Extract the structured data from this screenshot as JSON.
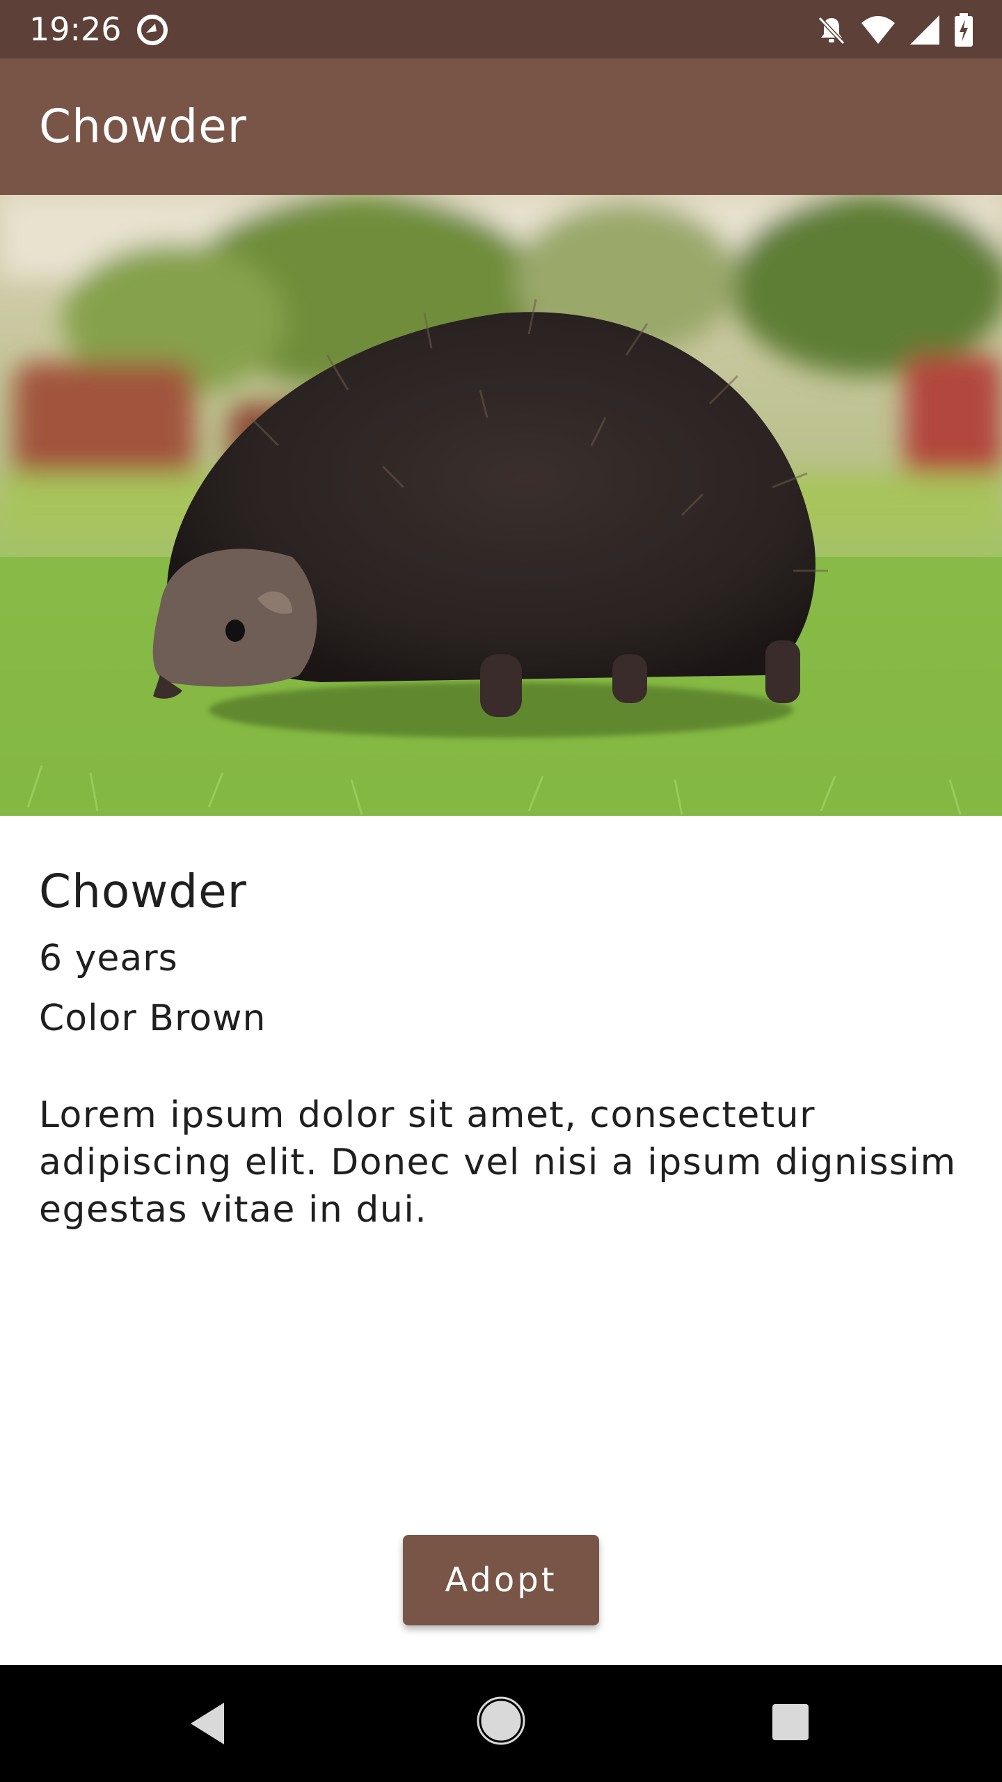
{
  "status_bar": {
    "time": "19:26",
    "icons": [
      "app-notification-icon",
      "notifications-off-icon",
      "wifi-icon",
      "cell-signal-icon",
      "battery-charging-icon"
    ]
  },
  "app_bar": {
    "title": "Chowder"
  },
  "hero_image": {
    "subject": "hedgehog-photo"
  },
  "pet": {
    "name": "Chowder",
    "age": "6 years",
    "color": "Color Brown",
    "description": "Lorem ipsum dolor sit amet, consectetur adipiscing elit. Donec vel nisi a ipsum dignissim egestas vitae in dui."
  },
  "actions": {
    "adopt_label": "Adopt"
  },
  "colors": {
    "status_bar": "#5d4037",
    "primary": "#795548",
    "nav_bar": "#000000"
  },
  "nav_bar": {
    "icons": [
      "back-icon",
      "home-icon",
      "recents-icon"
    ]
  }
}
